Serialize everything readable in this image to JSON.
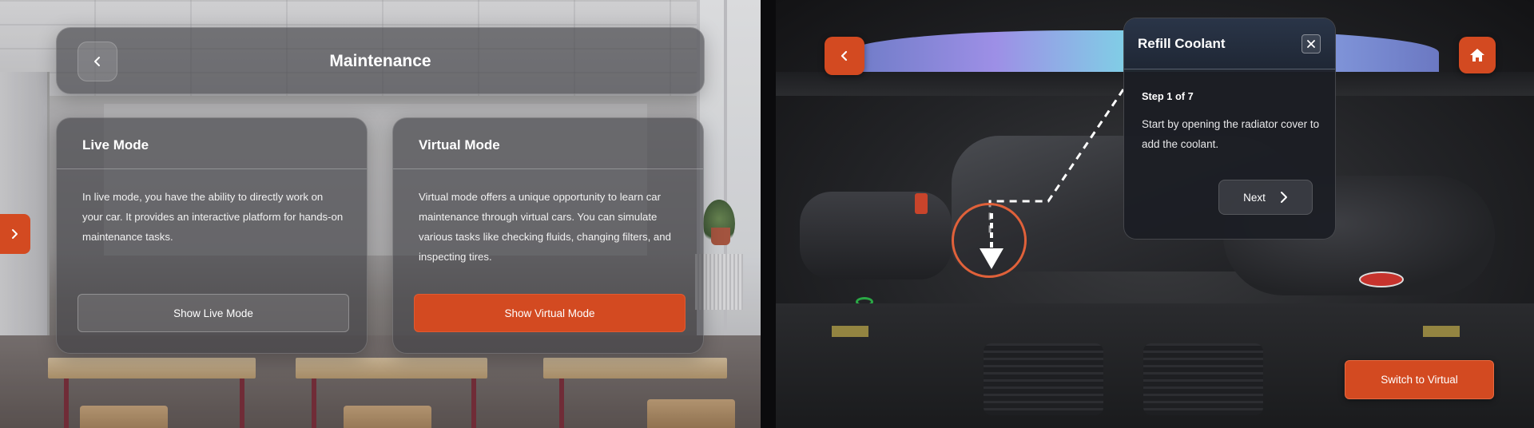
{
  "left": {
    "header": {
      "title": "Maintenance"
    },
    "live_mode": {
      "title": "Live Mode",
      "description": "In live mode, you have the ability to directly work on your car. It provides an interactive platform for hands-on maintenance tasks.",
      "button_label": "Show Live Mode"
    },
    "virtual_mode": {
      "title": "Virtual Mode",
      "description": "Virtual mode offers a unique opportunity to learn car maintenance through virtual cars. You can simulate various tasks like checking fluids, changing filters, and inspecting tires.",
      "button_label": "Show Virtual Mode"
    },
    "icons": {
      "back": "chevron-left-icon",
      "side_tab": "chevron-right-icon"
    }
  },
  "right": {
    "step_panel": {
      "title": "Refill Coolant",
      "step_counter": "Step 1 of 7",
      "instruction": "Start by opening the radiator cover to add the coolant.",
      "next_label": "Next"
    },
    "switch_button_label": "Switch to Virtual",
    "icons": {
      "back": "chevron-left-icon",
      "home": "home-icon",
      "close": "close-icon",
      "next": "chevron-right-icon",
      "target": "arrow-down-icon"
    }
  },
  "colors": {
    "accent": "#d34a21",
    "panel_dark": "#1c1e24",
    "glass": "#3c3c40"
  }
}
